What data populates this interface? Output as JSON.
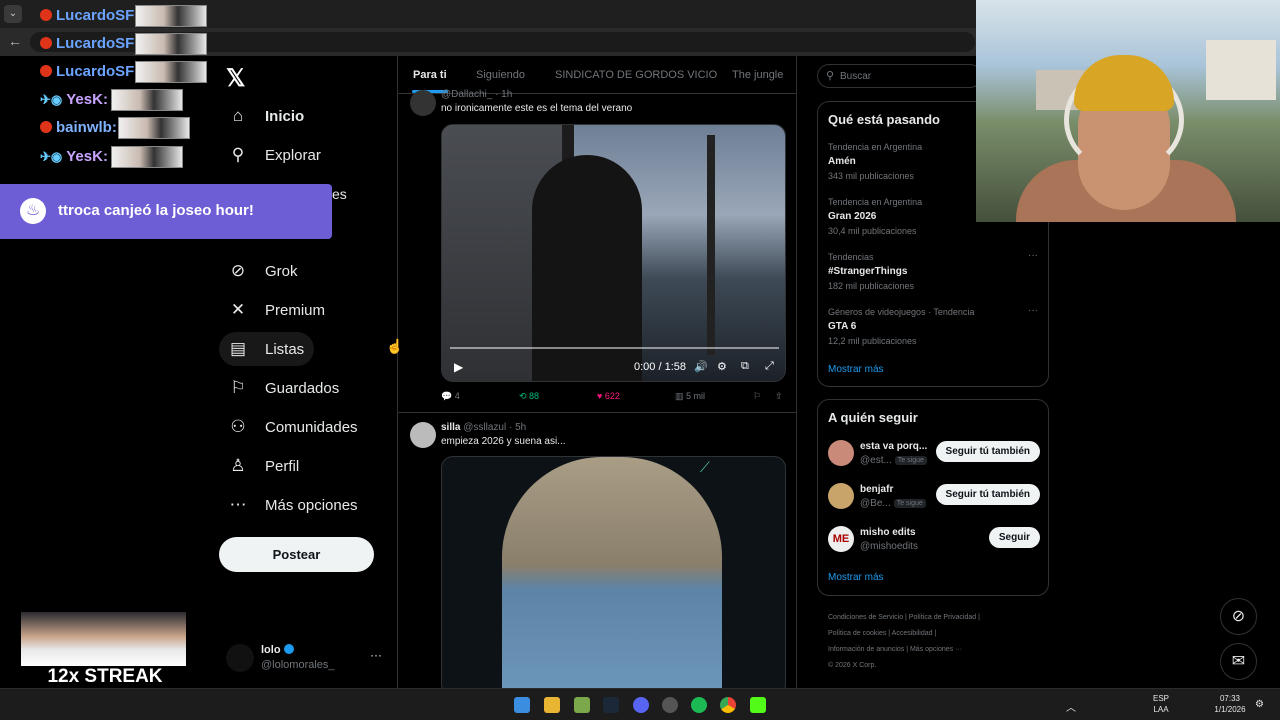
{
  "browser": {},
  "chat": {
    "lines": [
      {
        "user": "LucardoSF:"
      },
      {
        "user": "LucardoSF:"
      },
      {
        "user": "LucardoSF:"
      },
      {
        "user": "YesK:"
      },
      {
        "user": "bainwlb:"
      },
      {
        "user": "YesK:"
      }
    ],
    "redeem_text": "ttroca canjeó la joseo hour!"
  },
  "nav": {
    "items": [
      {
        "label": "Inicio",
        "icon": "home-icon"
      },
      {
        "label": "Explorar",
        "icon": "search-icon"
      },
      {
        "label": "Grok",
        "icon": "grok-icon"
      },
      {
        "label": "Premium",
        "icon": "x-icon"
      },
      {
        "label": "Listas",
        "icon": "list-icon"
      },
      {
        "label": "Guardados",
        "icon": "bookmark-icon"
      },
      {
        "label": "Comunidades",
        "icon": "communities-icon"
      },
      {
        "label": "Perfil",
        "icon": "profile-icon"
      },
      {
        "label": "Más opciones",
        "icon": "more-icon"
      }
    ],
    "partial_label": "es",
    "post_button": "Postear",
    "account": {
      "name": "lolo",
      "handle": "@lolomorales_"
    }
  },
  "timeline": {
    "tabs": [
      "Para ti",
      "Siguiendo",
      "SINDICATO DE GORDOS VICIO",
      "The jungle"
    ],
    "tweets": [
      {
        "header": "@Dallachi_ · 1h",
        "text": "no ironicamente este es el tema del verano",
        "video_time": "0:00 / 1:58",
        "replies": "4",
        "retweets": "88",
        "likes": "622",
        "views": "5 mil"
      },
      {
        "name": "silla",
        "handle": "@ssllazul · 5h",
        "text": "empieza 2026 y suena asi..."
      }
    ]
  },
  "sidebar": {
    "search_placeholder": "Buscar",
    "trends_title": "Qué está pasando",
    "trends": [
      {
        "context": "Tendencia en Argentina",
        "name": "Amén",
        "count": "343 mil publicaciones"
      },
      {
        "context": "Tendencia en Argentina",
        "name": "Gran 2026",
        "count": "30,4 mil publicaciones"
      },
      {
        "context": "Tendencias",
        "name": "#StrangerThings",
        "count": "182 mil publicaciones"
      },
      {
        "context": "Géneros de videojuegos · Tendencia",
        "name": "GTA 6",
        "count": "12,2 mil publicaciones"
      }
    ],
    "show_more": "Mostrar más",
    "follow_title": "A quién seguir",
    "follow": [
      {
        "name": "esta va porq...",
        "handle": "@est...",
        "badge": "Te sigue",
        "button": "Seguir tú también"
      },
      {
        "name": "benjafr",
        "handle": "@Be...",
        "badge": "Te sigue",
        "button": "Seguir tú también"
      },
      {
        "name": "misho edits",
        "handle": "@mishoedits",
        "badge": "",
        "button": "Seguir"
      }
    ],
    "footer": [
      "Condiciones de Servicio  |  Política de Privacidad  |",
      "Política de cookies  |  Accesibilidad  |",
      "Información de anuncios  |  Más opciones ···",
      "© 2026 X Corp."
    ]
  },
  "overlay": {
    "streak": "12x STREAK"
  },
  "taskbar": {
    "lang_top": "ESP",
    "lang_bottom": "LAA",
    "time": "07:33",
    "date": "1/1/2026"
  }
}
